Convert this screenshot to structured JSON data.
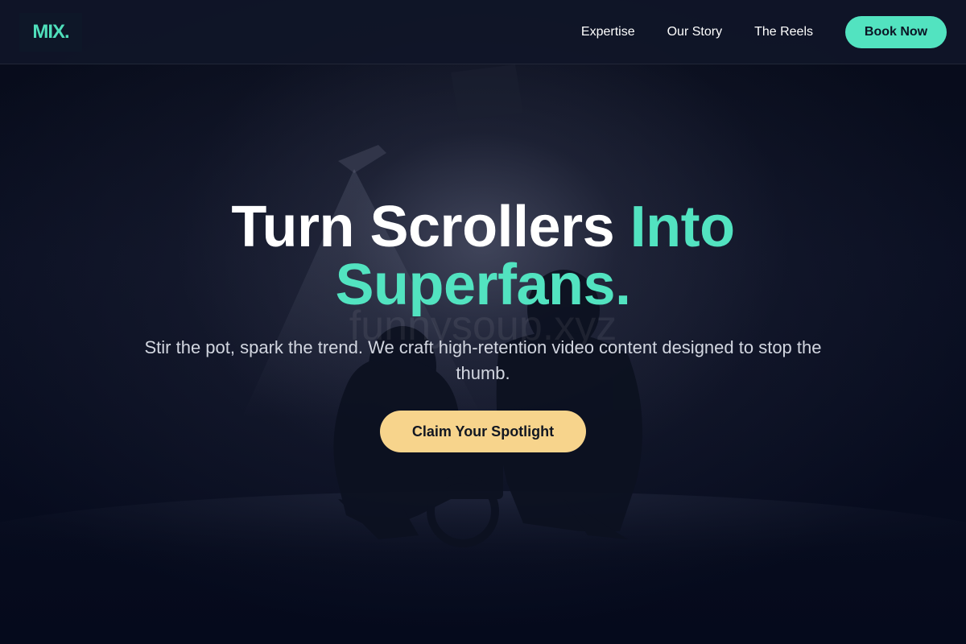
{
  "brand": {
    "logo": "MIX.",
    "accent_color": "#52e3c0"
  },
  "nav": {
    "links": [
      {
        "label": "Expertise"
      },
      {
        "label": "Our Story"
      },
      {
        "label": "The Reels"
      }
    ],
    "cta_label": "Book Now"
  },
  "hero": {
    "headline_part1": "Turn Scrollers ",
    "headline_accent_inline": "Into",
    "headline_accent_line2": "Superfans.",
    "subtitle": "Stir the pot, spark the trend. We craft high-retention video content designed to stop the thumb.",
    "cta_label": "Claim Your Spotlight",
    "cta_color": "#f7d48c",
    "watermark": "funnysoup.xyz",
    "background_image": "silhouette-of-videographer-with-camera-in-smoky-studio"
  }
}
